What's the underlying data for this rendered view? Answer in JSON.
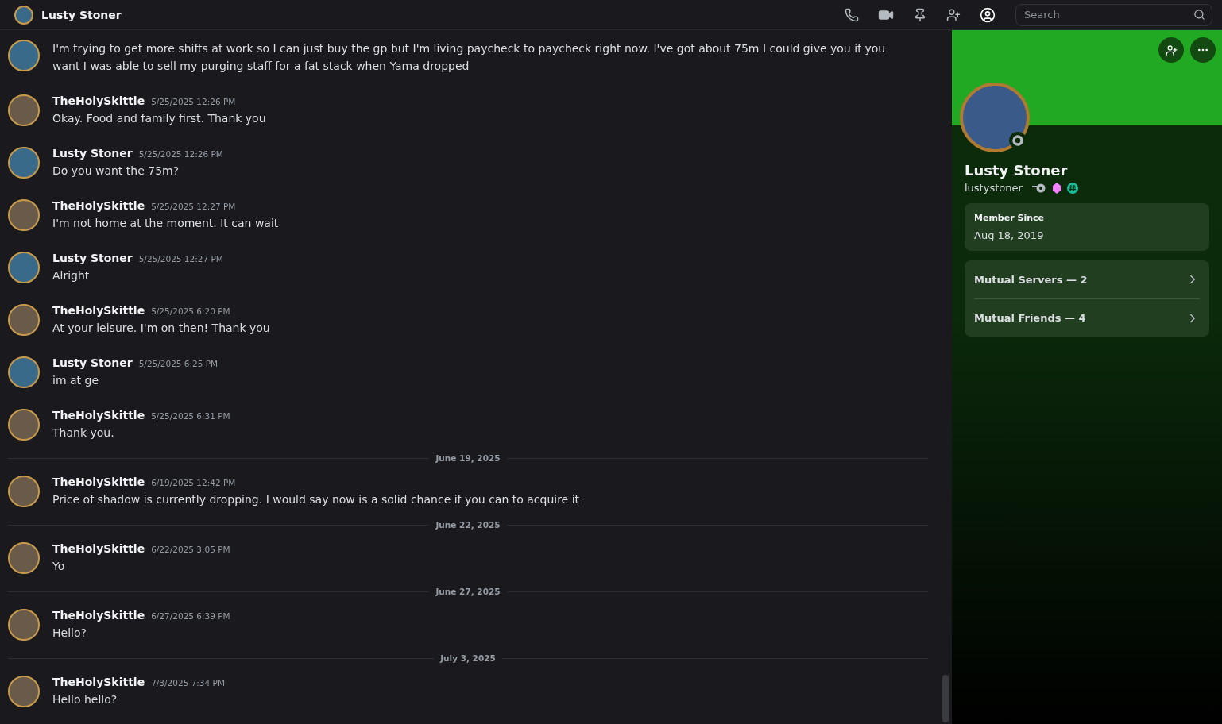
{
  "header": {
    "title": "Lusty Stoner",
    "search": {
      "placeholder": "Search"
    }
  },
  "messages": [
    {
      "kind": "continuation",
      "color": "#3a6a8a",
      "text": "I'm trying to get more shifts at work so I can just buy the gp but I'm living paycheck to paycheck right now. I've got about 75m I could give you if you want I was able to sell my purging staff for a fat stack when Yama dropped"
    },
    {
      "kind": "message",
      "color": "#6a5a4a",
      "author": "TheHolySkittle",
      "time": "5/25/2025 12:26 PM",
      "text": "Okay. Food and family first. Thank you"
    },
    {
      "kind": "message",
      "color": "#3a6a8a",
      "author": "Lusty Stoner",
      "time": "5/25/2025 12:26 PM",
      "text": "Do you want the 75m?"
    },
    {
      "kind": "message",
      "color": "#6a5a4a",
      "author": "TheHolySkittle",
      "time": "5/25/2025 12:27 PM",
      "text": "I'm not home at the moment. It can wait"
    },
    {
      "kind": "message",
      "color": "#3a6a8a",
      "author": "Lusty Stoner",
      "time": "5/25/2025 12:27 PM",
      "text": "Alright"
    },
    {
      "kind": "message",
      "color": "#6a5a4a",
      "author": "TheHolySkittle",
      "time": "5/25/2025 6:20 PM",
      "text": "At your leisure. I'm on then! Thank you"
    },
    {
      "kind": "message",
      "color": "#3a6a8a",
      "author": "Lusty Stoner",
      "time": "5/25/2025 6:25 PM",
      "text": "im at ge"
    },
    {
      "kind": "message",
      "color": "#6a5a4a",
      "author": "TheHolySkittle",
      "time": "5/25/2025 6:31 PM",
      "text": "Thank you."
    },
    {
      "kind": "divider",
      "text": "June 19, 2025"
    },
    {
      "kind": "message",
      "color": "#6a5a4a",
      "author": "TheHolySkittle",
      "time": "6/19/2025 12:42 PM",
      "text": "Price of shadow is currently dropping. I would say now is a solid chance if you can to acquire it"
    },
    {
      "kind": "divider",
      "text": "June 22, 2025"
    },
    {
      "kind": "message",
      "color": "#6a5a4a",
      "author": "TheHolySkittle",
      "time": "6/22/2025 3:05 PM",
      "text": "Yo"
    },
    {
      "kind": "divider",
      "text": "June 27, 2025"
    },
    {
      "kind": "message",
      "color": "#6a5a4a",
      "author": "TheHolySkittle",
      "time": "6/27/2025 6:39 PM",
      "text": "Hello?"
    },
    {
      "kind": "divider",
      "text": "July 3, 2025"
    },
    {
      "kind": "message",
      "color": "#6a5a4a",
      "author": "TheHolySkittle",
      "time": "7/3/2025 7:34 PM",
      "text": "Hello hello?"
    }
  ],
  "profile": {
    "display_name": "Lusty Stoner",
    "username": "lustystoner",
    "member_since_label": "Member Since",
    "member_since": "Aug 18, 2019",
    "links": [
      "Mutual Servers — 2",
      "Mutual Friends — 4"
    ]
  }
}
